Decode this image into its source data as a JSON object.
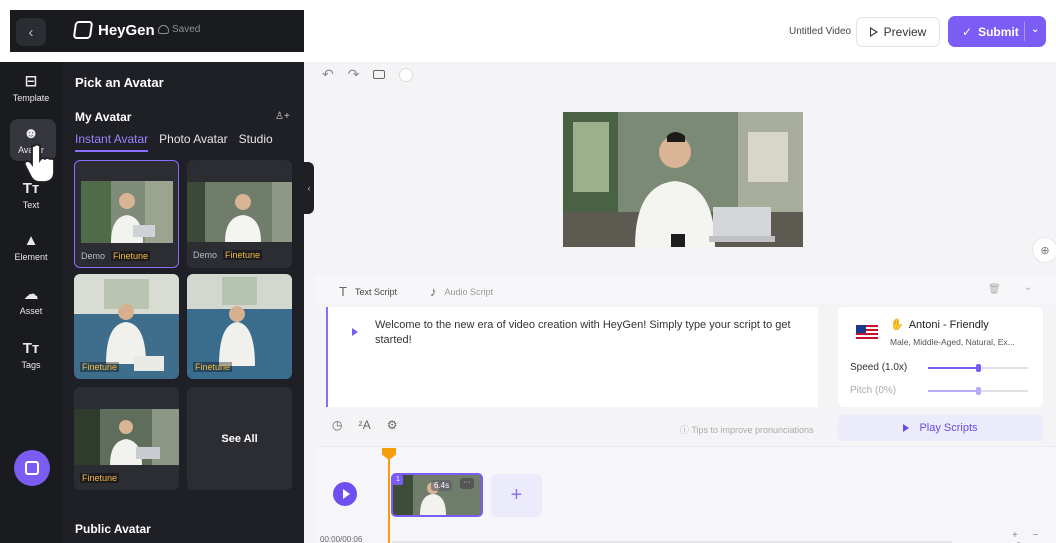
{
  "header": {
    "back_glyph": "‹",
    "brand": "HeyGen",
    "saved": "Saved",
    "video_title": "Untitled Video",
    "preview_label": "Preview",
    "submit_label": "Submit",
    "submit_check": "✓",
    "submit_caret": "⌄"
  },
  "nav": {
    "items": [
      {
        "label": "Template",
        "icon": "template-icon",
        "glyph": "⊟"
      },
      {
        "label": "Avatar",
        "icon": "avatar-icon",
        "glyph": "☻"
      },
      {
        "label": "Text",
        "icon": "text-icon",
        "glyph": "Tт"
      },
      {
        "label": "Element",
        "icon": "element-icon",
        "glyph": "▲"
      },
      {
        "label": "Asset",
        "icon": "asset-icon",
        "glyph": "☁"
      },
      {
        "label": "Tags",
        "icon": "tags-icon",
        "glyph": "Tт"
      }
    ],
    "active_index": 1
  },
  "panel": {
    "title": "Pick an Avatar",
    "section_title": "My Avatar",
    "add_user_glyph": "♙+",
    "tabs": [
      "Instant Avatar",
      "Photo Avatar",
      "Studio"
    ],
    "active_tab": 0,
    "cards": [
      {
        "demo": "Demo",
        "badge": "Finetune"
      },
      {
        "demo": "Demo",
        "badge": "Finetune"
      },
      {
        "demo": "",
        "badge": "Finetune"
      },
      {
        "demo": "",
        "badge": "Finetune"
      },
      {
        "demo": "",
        "badge": "Finetune"
      }
    ],
    "see_all": "See All",
    "public_title": "Public Avatar",
    "collapse_glyph": "‹"
  },
  "toolbar": {
    "undo": "↶",
    "redo": "↷",
    "zoom_glyph": "⊕"
  },
  "script": {
    "text_tab": "Text Script",
    "audio_tab": "Audio Script",
    "text_glyph": "T",
    "audio_glyph": "♪",
    "content": "Welcome to the new era of video creation with HeyGen! Simply type your script to get started!",
    "tools": [
      "◷",
      "ᶻA",
      "⚙"
    ],
    "tips": "ⓘ Tips to improve pronunciations",
    "trash_glyph": "🗑",
    "collapse_glyph": "⌄"
  },
  "voice": {
    "emoji": "✋",
    "name": "Antoni - Friendly",
    "desc": "Male, Middle-Aged, Natural, Ex...",
    "speed_label": "Speed (1.0x)",
    "pitch_label": "Pitch (0%)",
    "speed_level": 0.5,
    "pitch_level": 0.5,
    "play_scripts": "Play Scripts"
  },
  "timeline": {
    "clip_number": "1",
    "clip_duration": "6.4s",
    "clip_menu": "···",
    "add_glyph": "+",
    "timecode": "00:00/00:06",
    "zoom_controls": "+ − ⤢"
  },
  "colors": {
    "accent": "#7b5cf5",
    "finetune": "#f6b93b",
    "playhead": "#f59e0b",
    "sidebar": "#1a1b1f"
  }
}
